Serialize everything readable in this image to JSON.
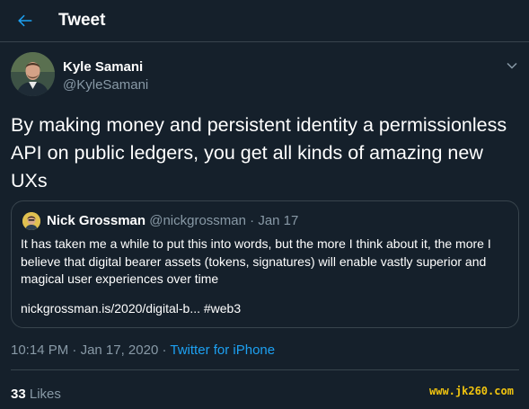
{
  "header": {
    "title": "Tweet"
  },
  "tweet": {
    "author_name": "Kyle Samani",
    "author_handle": "@KyleSamani",
    "text": "By making money and persistent identity a permissionless API on public ledgers, you get all kinds of amazing new UXs",
    "time": "10:14 PM",
    "date": "Jan 17, 2020",
    "separator": "·",
    "source": "Twitter for iPhone",
    "likes_count": "33",
    "likes_label": "Likes"
  },
  "quoted_tweet": {
    "author_name": "Nick Grossman",
    "author_handle": "@nickgrossman",
    "separator": "·",
    "date": "Jan 17",
    "text": "It has taken me a while to put this into words, but the more I think about it, the more I believe that digital bearer assets (tokens, signatures) will enable vastly superior and magical user experiences over time",
    "link": "nickgrossman.is/2020/digital-b... #web3"
  },
  "watermark": "www.jk260.com",
  "colors": {
    "background": "#15202b",
    "accent": "#1da1f2",
    "secondary_text": "#8899a6",
    "border": "#38444d"
  },
  "icons": {
    "back": "arrow-left-icon",
    "caret": "chevron-down-icon"
  }
}
